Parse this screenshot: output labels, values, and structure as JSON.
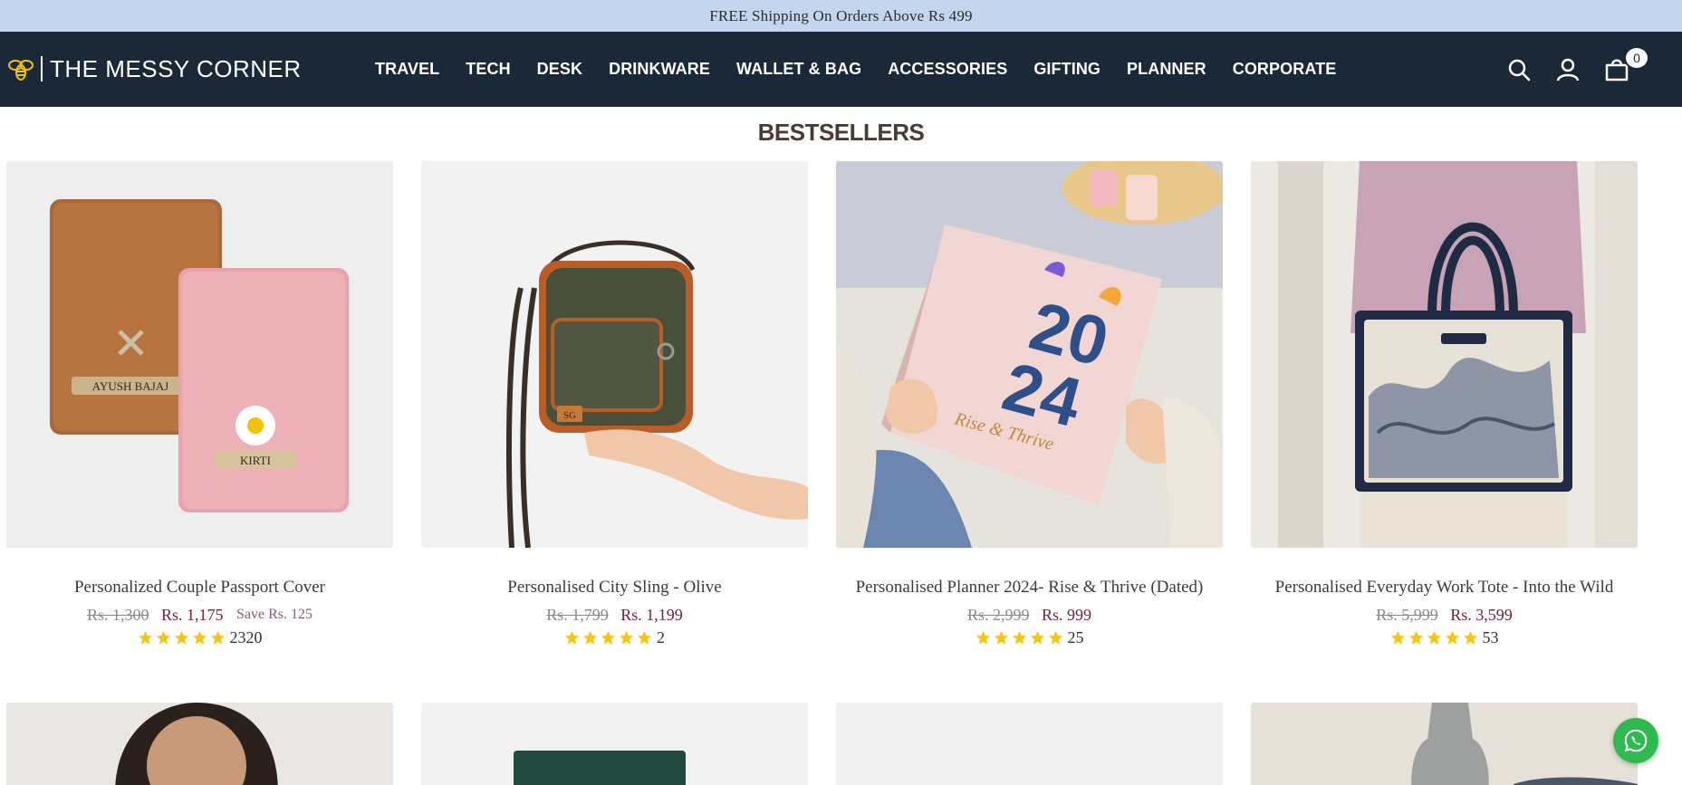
{
  "announcement": {
    "text": "FREE Shipping On Orders Above Rs 499"
  },
  "header": {
    "brand": "THE MESSY CORNER",
    "nav": [
      "TRAVEL",
      "TECH",
      "DESK",
      "DRINKWARE",
      "WALLET & BAG",
      "ACCESSORIES",
      "GIFTING",
      "PLANNER",
      "CORPORATE"
    ],
    "cart_count": "0",
    "icons": [
      "search-icon",
      "account-icon",
      "cart-icon"
    ]
  },
  "section": {
    "title": "BESTSELLERS"
  },
  "products": [
    {
      "title": "Personalized Couple Passport Cover",
      "old_price": "Rs. 1,300",
      "price": "Rs. 1,175",
      "save": "Save Rs. 125",
      "stars": 5,
      "reviews": "2320"
    },
    {
      "title": "Personalised City Sling - Olive",
      "old_price": "Rs. 1,799",
      "price": "Rs. 1,199",
      "save": "",
      "stars": 5,
      "reviews": "2"
    },
    {
      "title": "Personalised Planner 2024- Rise & Thrive (Dated)",
      "old_price": "Rs. 2,999",
      "price": "Rs. 999",
      "save": "",
      "stars": 5,
      "reviews": "25"
    },
    {
      "title": "Personalised Everyday Work Tote - Into the Wild",
      "old_price": "Rs. 5,999",
      "price": "Rs. 3,599",
      "save": "",
      "stars": 5,
      "reviews": "53"
    }
  ],
  "image_labels": {
    "passport_brown": "AYUSH BAJAJ",
    "passport_pink": "KIRTI",
    "sling_tag": "SG",
    "planner_year_top": "20",
    "planner_year_bottom": "24",
    "planner_subtitle": "Rise & Thrive"
  },
  "colors": {
    "header_bg": "#1b2838",
    "announcement_bg": "#c3d6ee",
    "price": "#7a1d3d",
    "star": "#f5c518",
    "whatsapp": "#2fba4f"
  }
}
